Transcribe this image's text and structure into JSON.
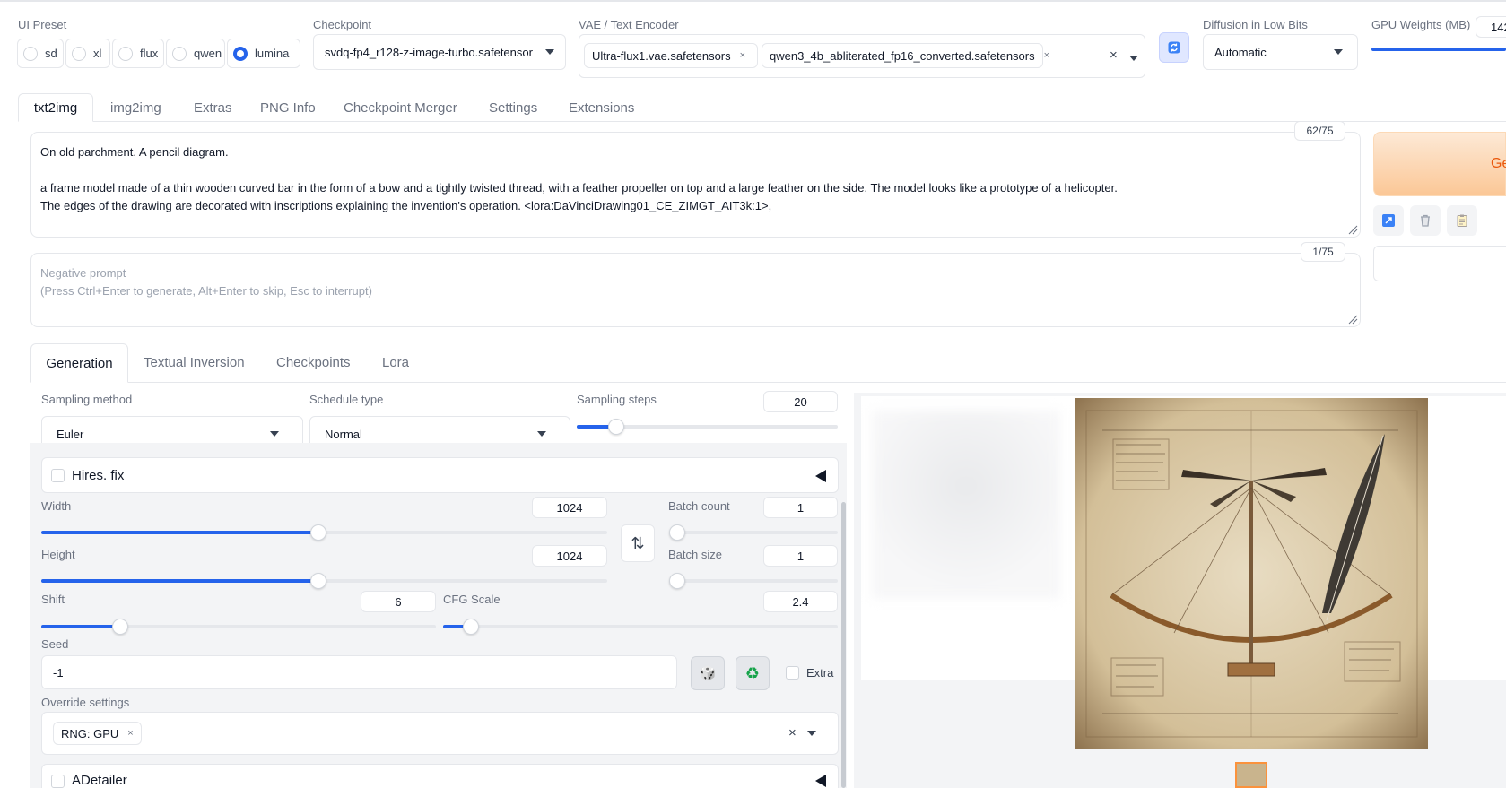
{
  "header": {
    "ui_preset": {
      "label": "UI Preset",
      "options": [
        "sd",
        "xl",
        "flux",
        "qwen",
        "lumina"
      ],
      "selected": "lumina"
    },
    "checkpoint": {
      "label": "Checkpoint",
      "value": "svdq-fp4_r128-z-image-turbo.safetensor"
    },
    "vae": {
      "label": "VAE / Text Encoder",
      "chips": [
        "Ultra-flux1.vae.safetensors",
        "qwen3_4b_abliterated_fp16_converted.safetensors"
      ],
      "clear": "×",
      "remove": "×"
    },
    "diffusion_low_bits": {
      "label": "Diffusion in Low Bits",
      "value": "Automatic"
    },
    "gpu_weights": {
      "label": "GPU Weights (MB)",
      "value": "142",
      "level": 1.0
    }
  },
  "main_tabs": [
    "txt2img",
    "img2img",
    "Extras",
    "PNG Info",
    "Checkpoint Merger",
    "Settings",
    "Extensions"
  ],
  "prompt": {
    "counter": "62/75",
    "line1": "On old parchment. A pencil diagram.",
    "line2": "a frame model made of a thin wooden curved bar in the form of a bow and a tightly twisted thread, with a feather propeller on top and a large feather on the side. The model looks like a prototype of a helicopter.",
    "line3": "The edges of the drawing are decorated with inscriptions explaining the invention's operation. <lora:DaVinciDrawing01_CE_ZIMGT_AIT3k:1>,"
  },
  "negative_prompt": {
    "counter": "1/75",
    "placeholder_line1": "Negative prompt",
    "placeholder_line2": "(Press Ctrl+Enter to generate, Alt+Enter to skip, Esc to interrupt)"
  },
  "generate": {
    "label": "Ge"
  },
  "sub_tabs": [
    "Generation",
    "Textual Inversion",
    "Checkpoints",
    "Lora"
  ],
  "generation": {
    "sampling_method": {
      "label": "Sampling method",
      "value": "Euler"
    },
    "schedule_type": {
      "label": "Schedule type",
      "value": "Normal"
    },
    "sampling_steps": {
      "label": "Sampling steps",
      "value": "20",
      "level": 0.15
    },
    "hires_fix": {
      "label": "Hires. fix"
    },
    "width": {
      "label": "Width",
      "value": "1024",
      "level": 0.49
    },
    "height": {
      "label": "Height",
      "value": "1024",
      "level": 0.49
    },
    "batch_count": {
      "label": "Batch count",
      "value": "1",
      "level": 0.0
    },
    "batch_size": {
      "label": "Batch size",
      "value": "1",
      "level": 0.0
    },
    "shift": {
      "label": "Shift",
      "value": "6",
      "level": 0.2
    },
    "cfg_scale": {
      "label": "CFG Scale",
      "value": "2.4",
      "level": 0.07
    },
    "seed": {
      "label": "Seed",
      "value": "-1"
    },
    "extra": {
      "label": "Extra"
    },
    "override_settings": {
      "label": "Override settings",
      "chip": "RNG: GPU",
      "chip_remove": "×",
      "clear": "×"
    },
    "adetailer": {
      "label": "ADetailer"
    }
  },
  "icons": {
    "swap": "⇅",
    "dice": "🎲",
    "recycle": "♻"
  },
  "colors": {
    "accent": "#2563eb",
    "generate_start": "#fde3cc",
    "generate_end": "#fbbf88",
    "generate_text": "#ea580c"
  }
}
